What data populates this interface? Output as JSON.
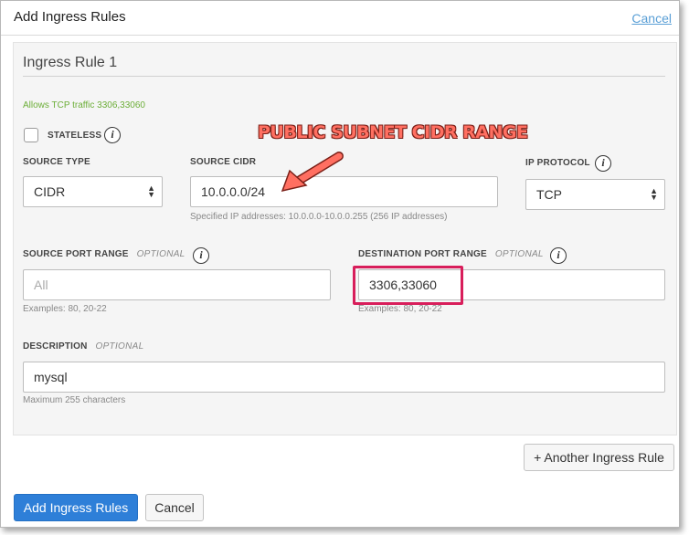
{
  "dialog": {
    "title": "Add Ingress Rules",
    "cancel_link": "Cancel"
  },
  "rule": {
    "title": "Ingress Rule 1",
    "allow_text": "Allows TCP traffic 3306,33060",
    "stateless": {
      "label": "STATELESS",
      "checked": false
    },
    "source_type": {
      "label": "SOURCE TYPE",
      "value": "CIDR"
    },
    "source_cidr": {
      "label": "SOURCE CIDR",
      "value": "10.0.0.0/24",
      "help": "Specified IP addresses: 10.0.0.0-10.0.0.255 (256 IP addresses)"
    },
    "ip_protocol": {
      "label": "IP PROTOCOL",
      "value": "TCP"
    },
    "source_port": {
      "label": "SOURCE PORT RANGE",
      "optional": "OPTIONAL",
      "placeholder": "All",
      "value": "",
      "help": "Examples: 80, 20-22"
    },
    "dest_port": {
      "label": "DESTINATION PORT RANGE",
      "optional": "OPTIONAL",
      "value": "3306,33060",
      "help": "Examples: 80, 20-22"
    },
    "description": {
      "label": "DESCRIPTION",
      "optional": "OPTIONAL",
      "value": "mysql",
      "help": "Maximum 255 characters"
    }
  },
  "annotation": {
    "text": "PUBLIC SUBNET CIDR RANGE",
    "color": "#ff6f61",
    "highlight_color": "#d81e5b"
  },
  "buttons": {
    "another_rule": "+ Another Ingress Rule",
    "add_rules": "Add Ingress Rules",
    "cancel": "Cancel"
  },
  "colors": {
    "primary": "#2e7fd8",
    "link": "#5a9fd6",
    "allow_text": "#6cae38"
  }
}
